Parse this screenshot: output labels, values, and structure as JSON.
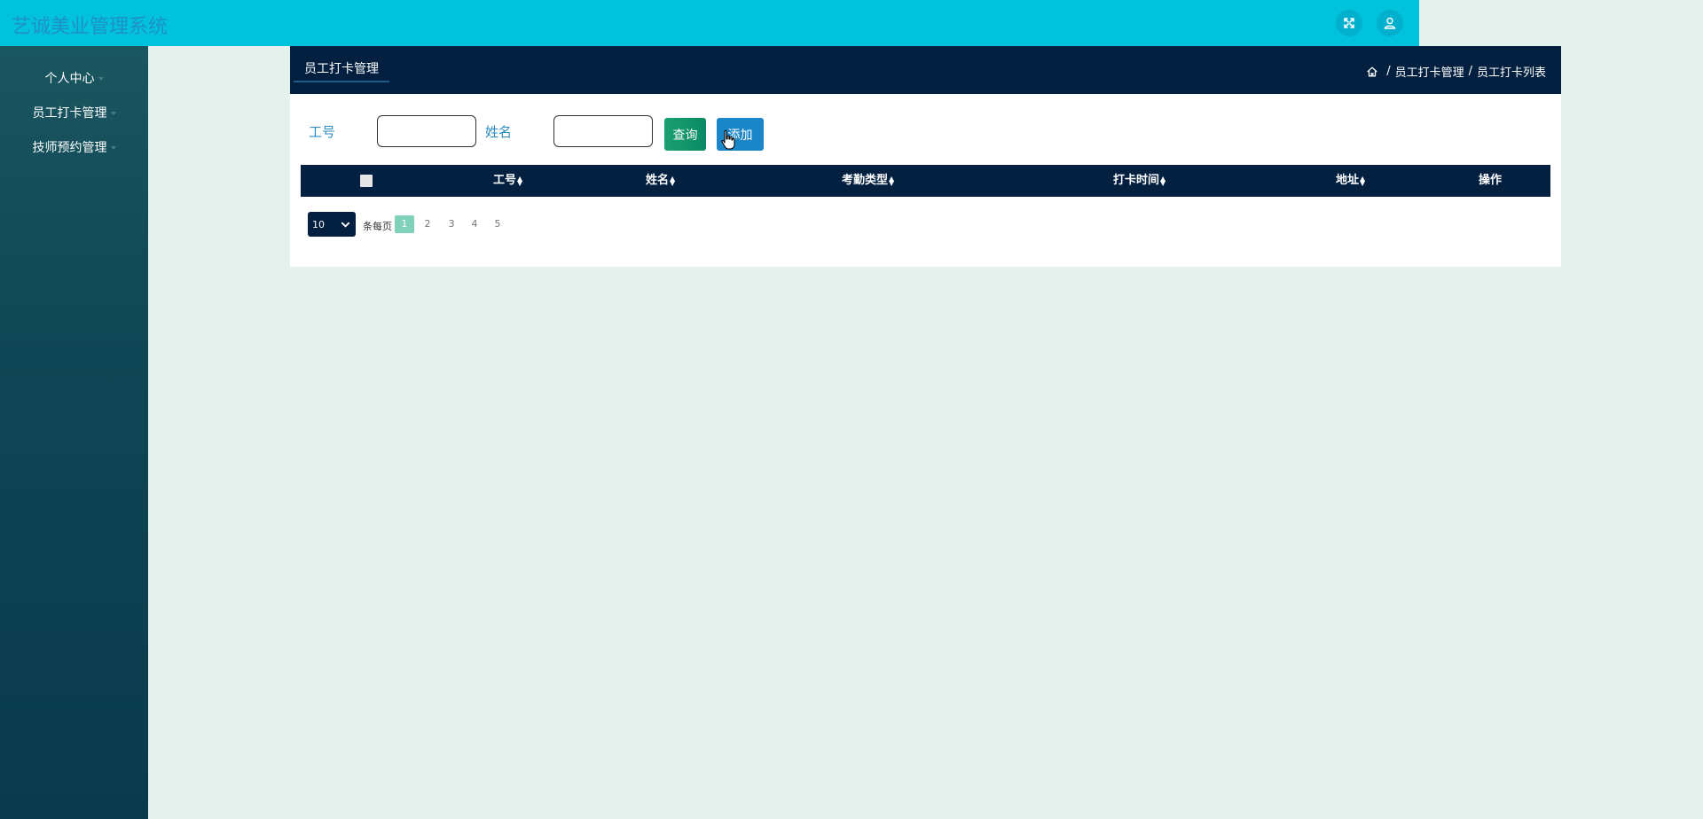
{
  "app": {
    "title": "艺诚美业管理系统"
  },
  "topbar": {
    "icons": [
      "fullscreen-icon",
      "user-icon"
    ]
  },
  "sidebar": {
    "items": [
      {
        "label": "个人中心"
      },
      {
        "label": "员工打卡管理"
      },
      {
        "label": "技师预约管理"
      }
    ]
  },
  "panel": {
    "tab_label": "员工打卡管理",
    "breadcrumb": [
      "员工打卡管理",
      "员工打卡列表"
    ],
    "breadcrumb_separator": "/"
  },
  "search": {
    "fields": [
      {
        "label": "工号",
        "value": ""
      },
      {
        "label": "姓名",
        "value": ""
      }
    ],
    "query_label": "查询",
    "add_label": "添加"
  },
  "table": {
    "columns": [
      "工号",
      "姓名",
      "考勤类型",
      "打卡时间",
      "地址",
      "操作"
    ],
    "sortable": [
      true,
      true,
      true,
      true,
      true,
      false
    ],
    "rows": []
  },
  "pagination": {
    "page_size": "10",
    "per_page_label": "条每页",
    "pages": [
      "1",
      "2",
      "3",
      "4",
      "5"
    ],
    "current_page": "1"
  },
  "colors": {
    "topbar": "#00c2dc",
    "sidebar": "#0f4655",
    "header_dark": "#032040",
    "query_button": "#1aa070",
    "add_button": "#1b87c8",
    "active_page": "#7fd1b9",
    "background": "#e4f1ec"
  }
}
